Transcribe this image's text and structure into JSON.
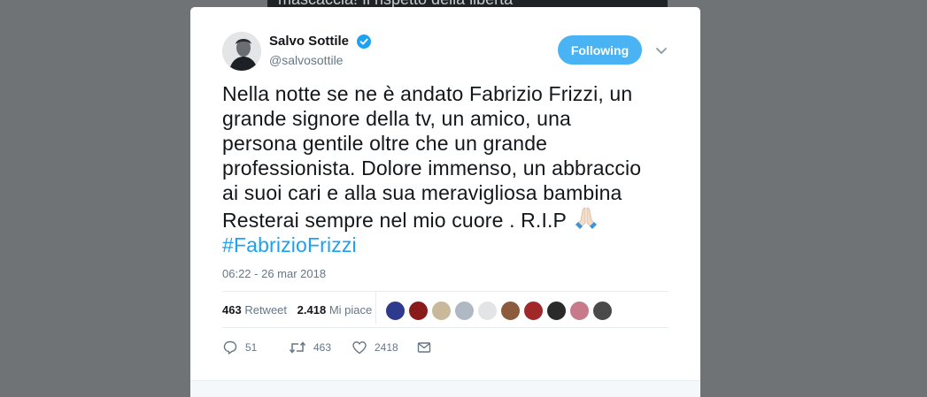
{
  "background_text": "mascaccia! Il rispetto della libertà",
  "author": {
    "name": "Salvo Sottile",
    "handle": "@salvosottile",
    "verified": true
  },
  "follow_button": "Following",
  "tweet": {
    "lines": [
      "Nella notte se ne è andato Fabrizio Frizzi, un",
      "grande signore della tv, un amico, una",
      "persona gentile  oltre che un grande",
      "professionista. Dolore immenso, un abbraccio",
      "ai suoi cari e alla sua meravigliosa bambina",
      "Resterai sempre nel mio cuore . R.I.P"
    ],
    "emoji": "folded-hands",
    "hashtag": "#FabrizioFrizzi"
  },
  "timestamp": "06:22 - 26 mar 2018",
  "stats": {
    "retweets_count": "463",
    "retweets_label": "Retweet",
    "likes_count": "2.418",
    "likes_label": "Mi piace"
  },
  "likers_colors": [
    "#2e3a8c",
    "#8b1a1a",
    "#c9b89a",
    "#b0b8c4",
    "#e2e4e6",
    "#8c5a3c",
    "#a02828",
    "#2a2a2a",
    "#c77a8a",
    "#4a4a4a"
  ],
  "actions": {
    "reply_count": "51",
    "retweet_count": "463",
    "like_count": "2418"
  },
  "colors": {
    "accent": "#1da1f2",
    "follow_button": "#4ab3f4",
    "text": "#14171a",
    "secondary_text": "#657786"
  }
}
